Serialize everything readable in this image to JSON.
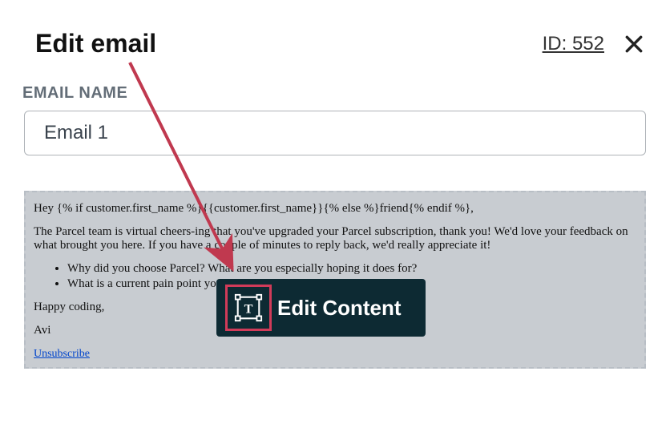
{
  "header": {
    "title": "Edit email",
    "id_label": "ID: 552"
  },
  "field": {
    "label": "EMAIL NAME",
    "value": "Email 1"
  },
  "preview": {
    "greeting": "Hey {% if customer.first_name %}{{customer.first_name}}{% else %}friend{% endif %},",
    "body1": "The Parcel team is virtual cheers-ing that you've upgraded your Parcel subscription, thank you! We'd love your feedback on what brought you here. If you have a couple of minutes to reply back, we'd really appreciate it!",
    "bullets": [
      "Why did you choose Parcel? What are you especially hoping it does for?",
      "What is a current pain point you are experiencing?"
    ],
    "signoff1": "Happy coding,",
    "signoff2": "Avi",
    "unsubscribe": "Unsubscribe"
  },
  "button": {
    "edit_content": "Edit Content"
  }
}
